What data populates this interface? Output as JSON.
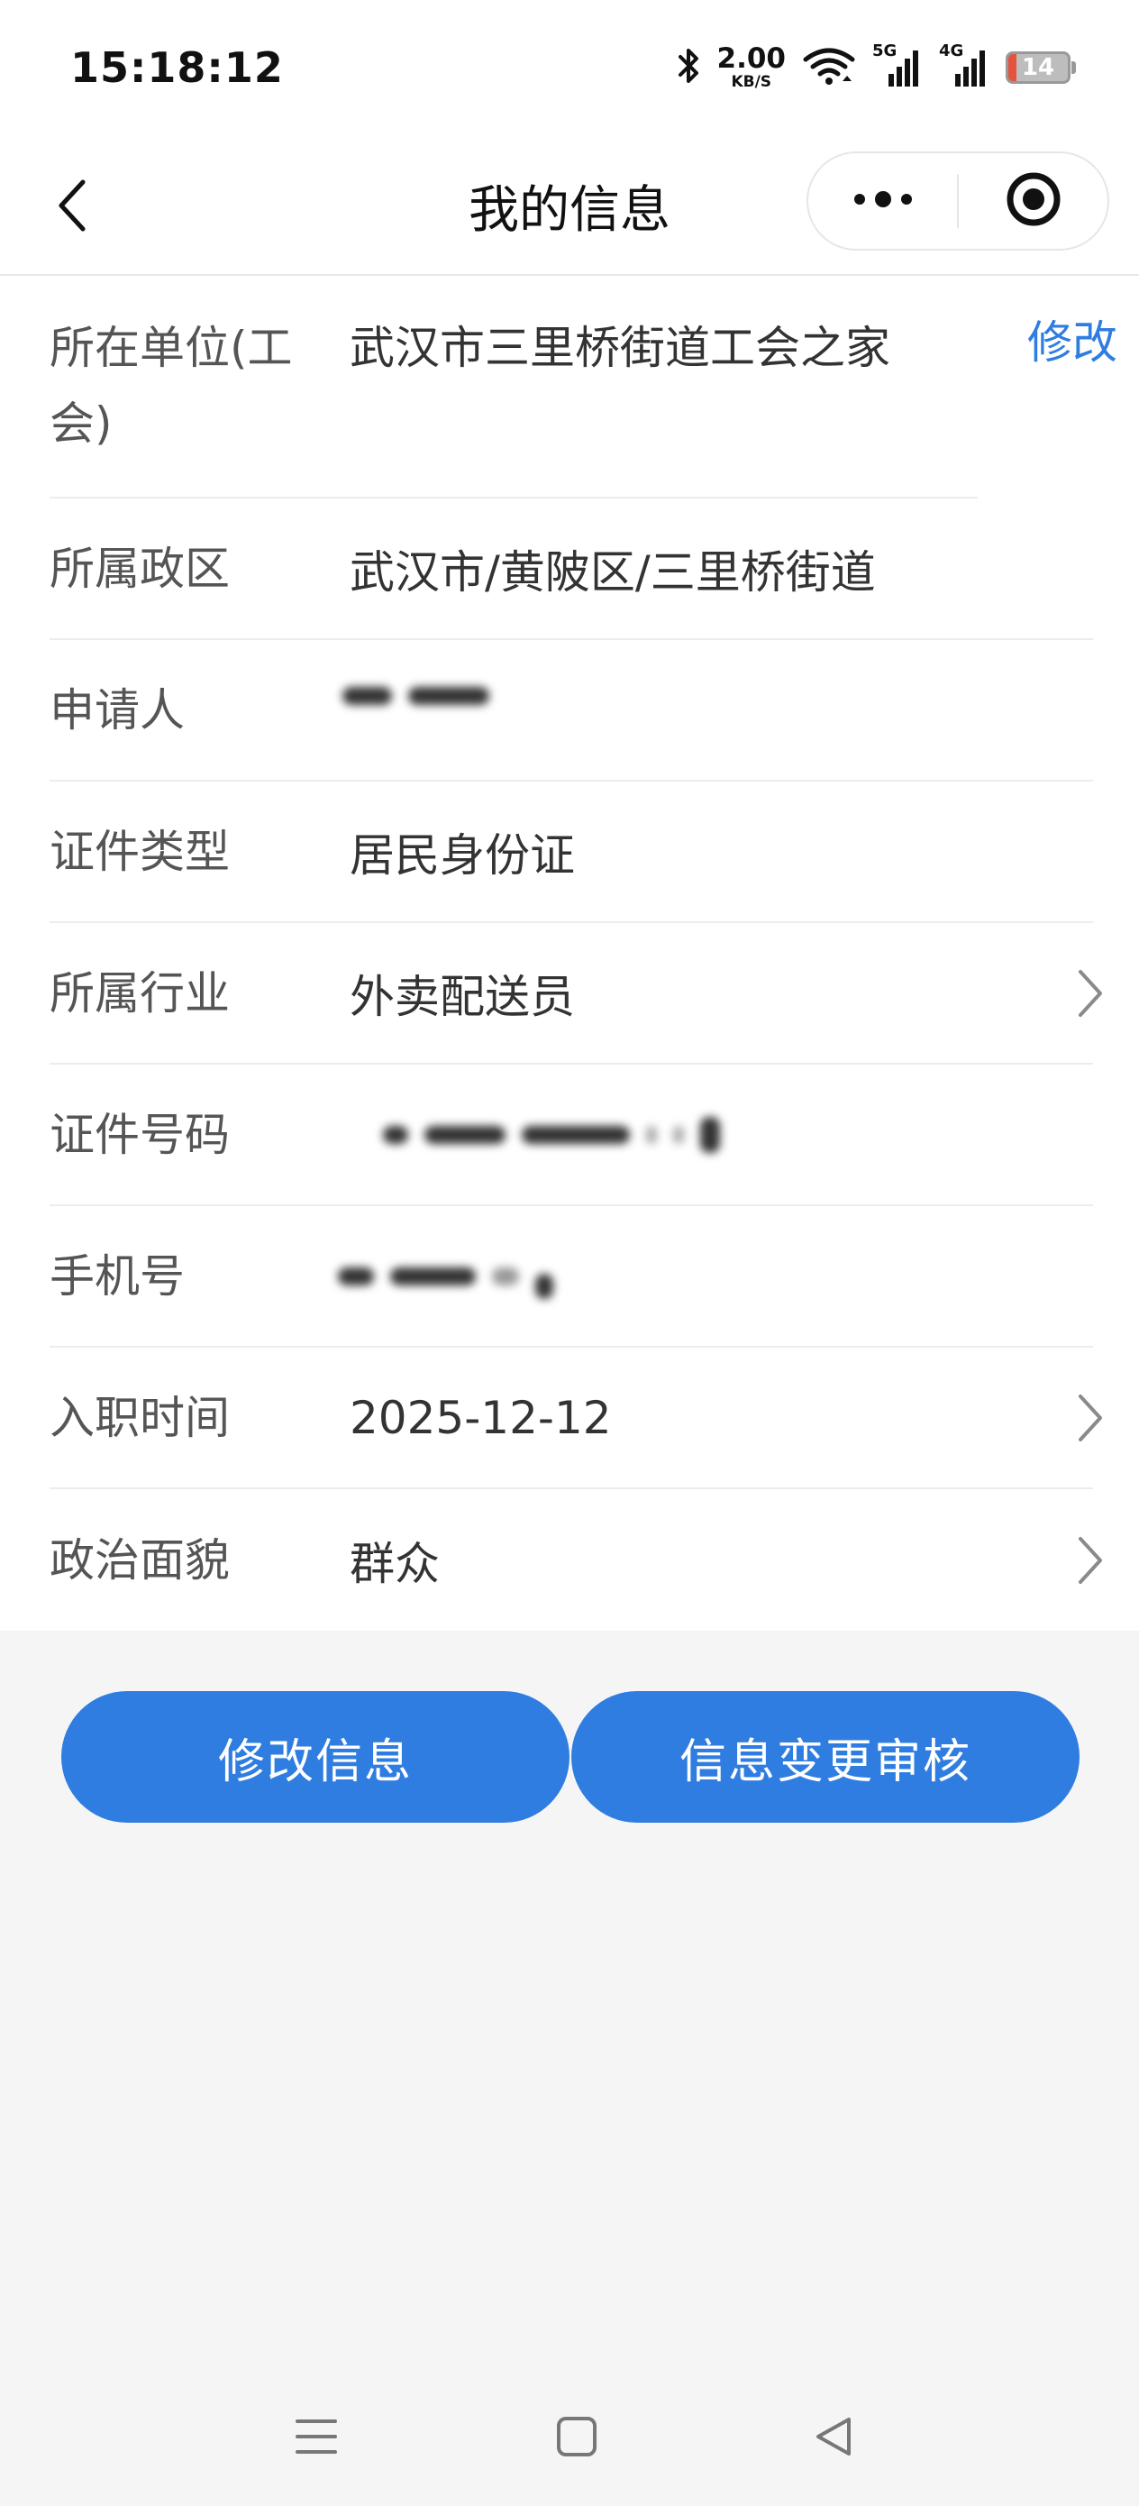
{
  "status_bar": {
    "time": "15:18:12",
    "net_speed_value": "2.00",
    "net_speed_unit": "KB/S",
    "signal_1_label": "5G",
    "signal_2_label": "4G",
    "battery_level": "14",
    "battery_fraction": 0.14,
    "icons": [
      "bluetooth-icon",
      "wifi-icon",
      "signal-5g-icon",
      "signal-4g-icon",
      "battery-icon"
    ]
  },
  "nav": {
    "title": "我的信息",
    "icons": [
      "back-icon",
      "more-dots-icon",
      "close-target-icon"
    ]
  },
  "form": {
    "edit_label": "修改",
    "rows": [
      {
        "label": "所在单位(工会)",
        "value": "武汉市三里桥街道工会之家"
      },
      {
        "label": "所属政区",
        "value": "武汉市/黄陂区/三里桥街道"
      },
      {
        "label": "申请人",
        "value": ""
      },
      {
        "label": "证件类型",
        "value": "居民身份证"
      },
      {
        "label": "所属行业",
        "value": "外卖配送员"
      },
      {
        "label": "证件号码",
        "value": ""
      },
      {
        "label": "手机号",
        "value": ""
      },
      {
        "label": "入职时间",
        "value": "2025-12-12"
      },
      {
        "label": "政治面貌",
        "value": "群众"
      }
    ]
  },
  "actions": {
    "modify_label": "修改信息",
    "review_label": "信息变更审核"
  },
  "colors": {
    "accent": "#2f7de1",
    "battery_low": "#e5533d",
    "background": "#f5f5f5"
  },
  "system_nav": {
    "icons": [
      "menu-icon",
      "home-square-icon",
      "back-triangle-icon"
    ]
  }
}
